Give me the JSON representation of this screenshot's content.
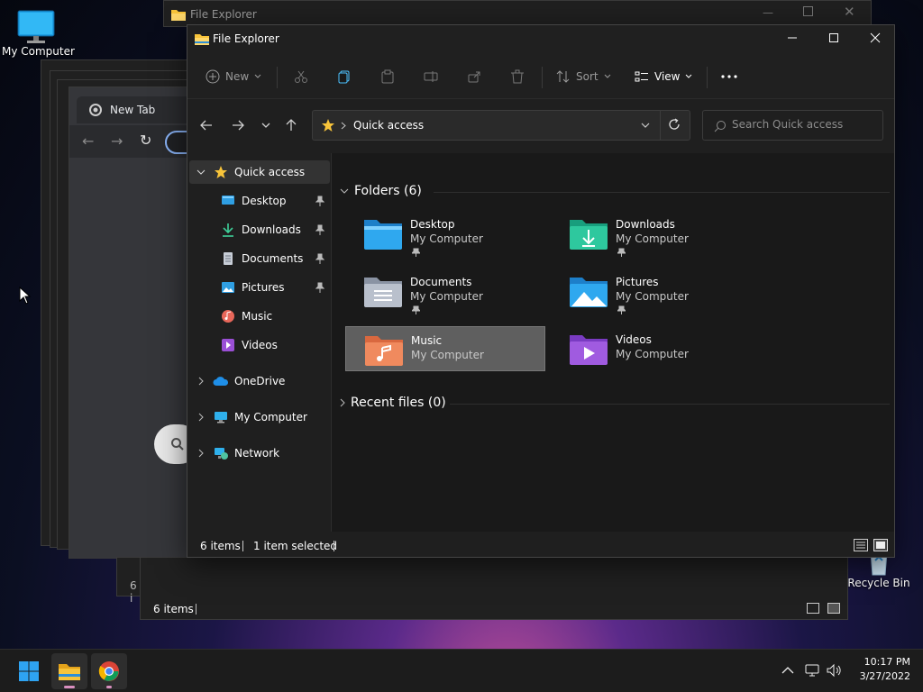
{
  "desktop": {
    "my_computer_label": "My Computer",
    "recycle_bin_label": "Recycle Bin"
  },
  "background_windows": {
    "explorer_title": "File Explorer",
    "status_items": "6 items",
    "status_partial": "6 i",
    "chrome_tab": "New Tab"
  },
  "explorer": {
    "title": "File Explorer",
    "toolbar": {
      "new_label": "New",
      "sort_label": "Sort",
      "view_label": "View"
    },
    "address": {
      "path": "Quick access"
    },
    "search": {
      "placeholder": "Search Quick access"
    },
    "sidebar": {
      "quick_access": "Quick access",
      "items": [
        {
          "label": "Desktop"
        },
        {
          "label": "Downloads"
        },
        {
          "label": "Documents"
        },
        {
          "label": "Pictures"
        },
        {
          "label": "Music"
        },
        {
          "label": "Videos"
        }
      ],
      "onedrive": "OneDrive",
      "my_computer": "My Computer",
      "network": "Network"
    },
    "content": {
      "folders_header": "Folders (6)",
      "recent_header": "Recent files (0)",
      "folders": [
        {
          "name": "Desktop",
          "location": "My Computer"
        },
        {
          "name": "Downloads",
          "location": "My Computer"
        },
        {
          "name": "Documents",
          "location": "My Computer"
        },
        {
          "name": "Pictures",
          "location": "My Computer"
        },
        {
          "name": "Music",
          "location": "My Computer"
        },
        {
          "name": "Videos",
          "location": "My Computer"
        }
      ]
    },
    "status": {
      "items": "6 items",
      "selected": "1 item selected"
    }
  },
  "taskbar": {
    "time": "10:17 PM",
    "date": "3/27/2022"
  },
  "colors": {
    "accent": "#4cc2ff",
    "selection": "#5f5f5f",
    "folder_yellow": "#f8c43a"
  }
}
